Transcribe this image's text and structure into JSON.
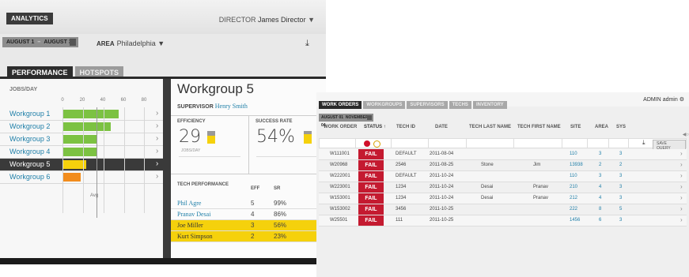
{
  "left": {
    "analytics": "ANALYTICS",
    "director_label": "DIRECTOR",
    "director_name": "James Director",
    "date_from": "AUGUST 1",
    "date_sep": "–",
    "date_to": "AUGUST 31",
    "area_label": "AREA",
    "area_value": "Philadelphia",
    "tabs": [
      "PERFORMANCE",
      "HOTSPOTS"
    ],
    "jobs_label": "JOBS/DAY",
    "axis_ticks": [
      "0",
      "20",
      "40",
      "60",
      "80"
    ],
    "avg_label": "Avg",
    "workgroups": [
      {
        "name": "Workgroup 1",
        "value": 55,
        "color": "#7cc242"
      },
      {
        "name": "Workgroup 2",
        "value": 47,
        "color": "#7cc242"
      },
      {
        "name": "Workgroup 3",
        "value": 34,
        "color": "#7cc242"
      },
      {
        "name": "Workgroup 4",
        "value": 34,
        "color": "#7cc242"
      },
      {
        "name": "Workgroup 5",
        "value": 23,
        "color": "#f5d10c"
      },
      {
        "name": "Workgroup 6",
        "value": 18,
        "color": "#f28c1c"
      }
    ],
    "selected_index": 4,
    "detail": {
      "title": "Workgroup 5",
      "supervisor_label": "SUPERVISOR",
      "supervisor_name": "Henry Smith",
      "efficiency_label": "EFFICIENCY",
      "efficiency_value": "29",
      "efficiency_sub": "JOBS/DAY",
      "success_label": "SUCCESS RATE",
      "success_value": "54%",
      "tech_perf_label": "TECH PERFORMANCE",
      "col_eff": "EFF",
      "col_sr": "SR",
      "techs": [
        {
          "name": "Phil Agre",
          "eff": "5",
          "sr": "99%",
          "highlight": false
        },
        {
          "name": "Pranav Desai",
          "eff": "4",
          "sr": "86%",
          "highlight": false
        },
        {
          "name": "Joe Miller",
          "eff": "3",
          "sr": "56%",
          "highlight": true
        },
        {
          "name": "Kurt Simpson",
          "eff": "2",
          "sr": "23%",
          "highlight": true
        }
      ]
    }
  },
  "right": {
    "tabs": [
      "WORK ORDERS",
      "WORKGROUPS",
      "SUPERVISORS",
      "TECHS",
      "INVENTORY"
    ],
    "admin_label": "ADMIN",
    "admin_name": "admin",
    "date_from": "AUGUST 01",
    "date_to": "NOVEMBER 04",
    "columns": [
      "WORK ORDER",
      "STATUS ↑",
      "TECH ID",
      "DATE",
      "TECH LAST NAME",
      "TECH FIRST NAME",
      "SITE",
      "AREA",
      "SYS"
    ],
    "save_query": "SAVE QUERY",
    "rows": [
      {
        "wo": "W111001",
        "status": "FAIL",
        "tech": "DEFAULT",
        "date": "2011-08-04",
        "last": "",
        "first": "",
        "site": "110",
        "area": "3",
        "sys": "3"
      },
      {
        "wo": "W20968",
        "status": "FAIL",
        "tech": "2546",
        "date": "2011-08-25",
        "last": "Stone",
        "first": "Jim",
        "site": "13938",
        "area": "2",
        "sys": "2"
      },
      {
        "wo": "W222001",
        "status": "FAIL",
        "tech": "DEFAULT",
        "date": "2011-10-24",
        "last": "",
        "first": "",
        "site": "110",
        "area": "3",
        "sys": "3"
      },
      {
        "wo": "W223001",
        "status": "FAIL",
        "tech": "1234",
        "date": "2011-10-24",
        "last": "Desai",
        "first": "Pranav",
        "site": "210",
        "area": "4",
        "sys": "3"
      },
      {
        "wo": "W153001",
        "status": "FAIL",
        "tech": "1234",
        "date": "2011-10-24",
        "last": "Desai",
        "first": "Pranav",
        "site": "212",
        "area": "4",
        "sys": "3"
      },
      {
        "wo": "W153002",
        "status": "FAIL",
        "tech": "3456",
        "date": "2011-10-25",
        "last": "",
        "first": "",
        "site": "222",
        "area": "8",
        "sys": "5"
      },
      {
        "wo": "W25501",
        "status": "FAIL",
        "tech": "111",
        "date": "2011-10-25",
        "last": "",
        "first": "",
        "site": "1456",
        "area": "6",
        "sys": "3"
      }
    ]
  },
  "chart_data": {
    "type": "bar",
    "categories": [
      "Workgroup 1",
      "Workgroup 2",
      "Workgroup 3",
      "Workgroup 4",
      "Workgroup 5",
      "Workgroup 6"
    ],
    "values": [
      55,
      47,
      34,
      34,
      23,
      18
    ],
    "title": "",
    "xlabel": "JOBS/DAY",
    "ylabel": "",
    "xlim": [
      0,
      80
    ],
    "orientation": "horizontal",
    "annotations": [
      "Avg"
    ]
  }
}
